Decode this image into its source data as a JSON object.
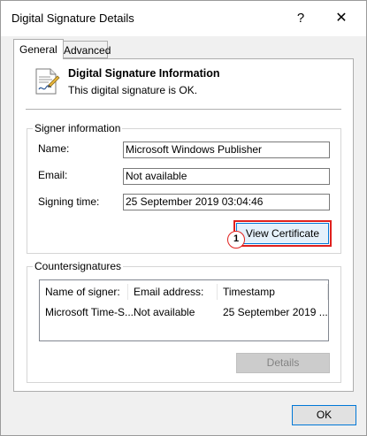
{
  "window": {
    "title": "Digital Signature Details",
    "help_glyph": "?",
    "close_glyph": "✕"
  },
  "tabs": [
    {
      "label": "General",
      "active": true
    },
    {
      "label": "Advanced",
      "active": false
    }
  ],
  "header": {
    "title": "Digital Signature Information",
    "status": "This digital signature is OK.",
    "icon": "certificate-document-icon"
  },
  "signer": {
    "group_label": "Signer information",
    "name_label": "Name:",
    "name_value": "Microsoft Windows Publisher",
    "email_label": "Email:",
    "email_value": "Not available",
    "time_label": "Signing time:",
    "time_value": "25 September 2019 03:04:46",
    "view_certificate_label": "View Certificate",
    "callout_number": "1"
  },
  "countersignatures": {
    "group_label": "Countersignatures",
    "columns": [
      "Name of signer:",
      "Email address:",
      "Timestamp"
    ],
    "rows": [
      [
        "Microsoft Time-S...",
        "Not available",
        "25 September 2019 ..."
      ]
    ],
    "details_label": "Details"
  },
  "footer": {
    "ok_label": "OK"
  },
  "colors": {
    "highlight": "#e0201d",
    "focus_border": "#0078d7"
  }
}
